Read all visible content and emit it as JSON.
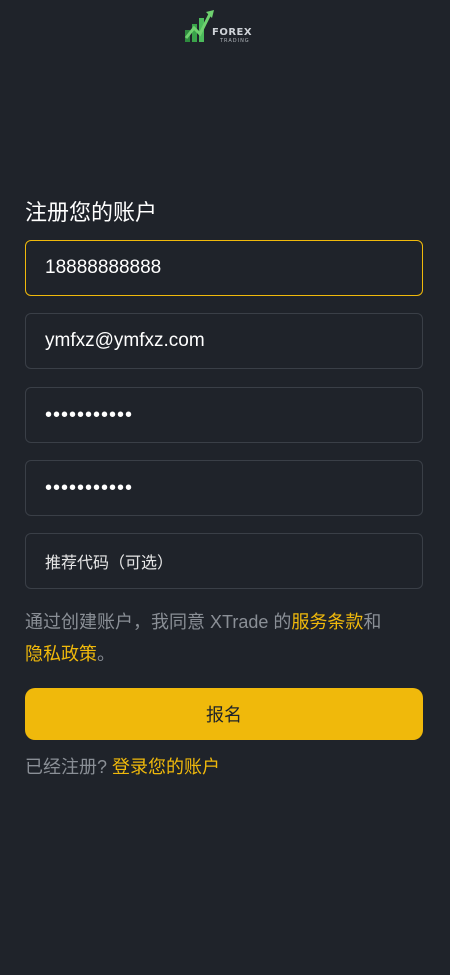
{
  "brand": {
    "logo_text": "FOREX",
    "logo_sub": "TRADING"
  },
  "form": {
    "title": "注册您的账户",
    "phone_value": "18888888888",
    "email_value": "ymfxz@ymfxz.com",
    "password_mask": "•••••••••••",
    "confirm_password_mask": "•••••••••••",
    "referral_placeholder": "推荐代码（可选）"
  },
  "terms": {
    "prefix": "通过创建账户，我同意 XTrade 的",
    "terms_link": "服务条款",
    "and": "和",
    "privacy_link": "隐私政策",
    "suffix": "。"
  },
  "signup_button": "报名",
  "login": {
    "prompt": "已经注册?",
    "link": "登录您的账户"
  },
  "colors": {
    "background": "#1f232a",
    "accent": "#f0b90b",
    "border": "#3a3f47",
    "muted_text": "#8a8f96"
  }
}
